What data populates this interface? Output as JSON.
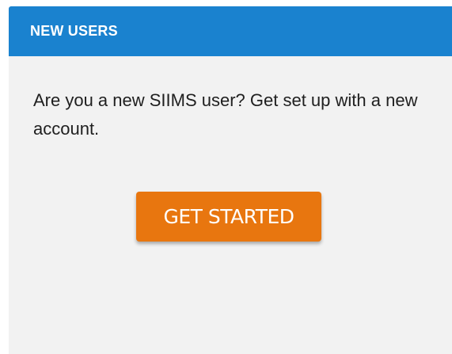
{
  "panel": {
    "title": "NEW USERS",
    "message": "Are you a new SIIMS user? Get set up with a new account.",
    "button_label": "GET STARTED"
  },
  "colors": {
    "header_bg": "#1a82cf",
    "panel_bg": "#f2f2f2",
    "button_bg": "#e8760f",
    "text": "#1f1f1f"
  }
}
